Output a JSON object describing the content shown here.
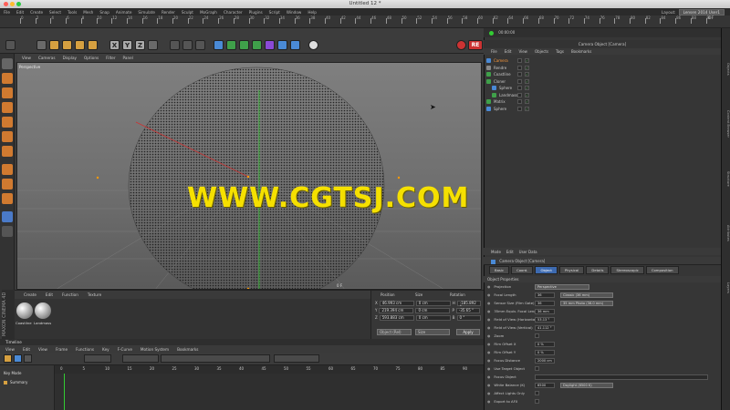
{
  "window": {
    "title": "Untitled 12 *"
  },
  "menubar": {
    "items": [
      "File",
      "Edit",
      "Create",
      "Select",
      "Tools",
      "Mesh",
      "Snap",
      "Animate",
      "Simulate",
      "Render",
      "Sculpt",
      "MoGraph",
      "Character",
      "Plugins",
      "Script",
      "Window",
      "Help"
    ],
    "layout_label": "Layout:",
    "layout_value": "Lensen 2014 User1"
  },
  "time_ruler": {
    "ticks": [
      "0",
      "2",
      "4",
      "6",
      "8",
      "10",
      "12",
      "14",
      "16",
      "18",
      "20",
      "22",
      "24",
      "26",
      "28",
      "30",
      "32",
      "34",
      "36",
      "38",
      "40",
      "42",
      "44",
      "46",
      "48",
      "50",
      "52",
      "54",
      "56",
      "58",
      "60",
      "62",
      "64",
      "66",
      "68",
      "70",
      "72",
      "74",
      "76",
      "78",
      "80",
      "82",
      "84",
      "86",
      "88",
      "90"
    ],
    "end_label": "0 F",
    "start_field": "0 F",
    "end_field": "90 F",
    "frame_field": "0 F"
  },
  "toolbar": {
    "axis_labels": [
      "X",
      "Y",
      "Z"
    ],
    "render_badge": "RE"
  },
  "viewport": {
    "menu": [
      "View",
      "Cameras",
      "Display",
      "Options",
      "Filter",
      "Panel"
    ],
    "label": "Perspective",
    "watermark": "WWW.CGTSJ.COM",
    "corner_label": "0 F"
  },
  "material_manager": {
    "menu": [
      "Create",
      "Edit",
      "Function",
      "Texture"
    ],
    "materials": [
      "Coastline",
      "Landmass"
    ],
    "vertical_label": "MAXON CINEMA 4D"
  },
  "coordinates": {
    "headers": [
      "Position",
      "Size",
      "Rotation"
    ],
    "rows": [
      {
        "axis": "X",
        "pos": "46.993 cm",
        "size": "0 cm",
        "rot": "H",
        "rot_val": "-185.892 °"
      },
      {
        "axis": "Y",
        "pos": "219.394 cm",
        "size": "0 cm",
        "rot": "P",
        "rot_val": "-35.65 °"
      },
      {
        "axis": "Z",
        "pos": "593.883 cm",
        "size": "0 cm",
        "rot": "B",
        "rot_val": "0 °"
      }
    ],
    "mode_select": "Object (Rel)",
    "size_select": "Size",
    "apply_label": "Apply"
  },
  "timeline": {
    "title": "Timeline",
    "menu": [
      "View",
      "Edit",
      "View",
      "Frame",
      "Functions",
      "Key",
      "F-Curve",
      "Motion System",
      "Bookmarks"
    ],
    "key_mode": "Key Mode",
    "summary": "Summary",
    "ruler": [
      "0",
      "5",
      "10",
      "15",
      "20",
      "25",
      "30",
      "35",
      "40",
      "45",
      "50",
      "55",
      "60",
      "65",
      "70",
      "75",
      "80",
      "85",
      "90"
    ]
  },
  "object_manager": {
    "time_display": "00:00:00",
    "title": "Camera Object [Camera]",
    "menu": [
      "File",
      "Edit",
      "View",
      "Objects",
      "Tags",
      "Bookmarks"
    ],
    "objects": [
      {
        "name": "Camera",
        "color": "#ff9a3a"
      },
      {
        "name": "Rendre",
        "color": "#cccccc"
      },
      {
        "name": "Coastline",
        "color": "#cccccc"
      },
      {
        "name": "Cloner",
        "color": "#cccccc"
      },
      {
        "name": "Sphere",
        "color": "#cccccc"
      },
      {
        "name": "Landmass",
        "color": "#cccccc"
      },
      {
        "name": "Matrix",
        "color": "#cccccc"
      },
      {
        "name": "Sphere",
        "color": "#cccccc"
      }
    ]
  },
  "attributes": {
    "menu": [
      "Mode",
      "Edit",
      "User Data"
    ],
    "title": "Camera Object [Camera]",
    "tabs": [
      "Basic",
      "Coord.",
      "Object",
      "Physical",
      "Details",
      "Stereoscopic",
      "Composition"
    ],
    "active_tab": "Object",
    "section": "Object Properties",
    "rows": [
      {
        "label": "Projection",
        "value": "Perspective",
        "kind": "drop"
      },
      {
        "label": "Focal Length",
        "value": "36",
        "extra": "Classic (36 mm)"
      },
      {
        "label": "Sensor Size (Film Gate)",
        "value": "36",
        "extra": "35 mm Photo (36.0 mm)"
      },
      {
        "label": "35mm Equiv. Focal Length:",
        "value": "36 mm"
      },
      {
        "label": "Field of View (Horizontal)",
        "value": "53.13 °"
      },
      {
        "label": "Field of View (Vertical)",
        "value": "41.112 °"
      },
      {
        "label": "Zoom",
        "value": ""
      },
      {
        "label": "Film Offset X",
        "value": "0 %"
      },
      {
        "label": "Film Offset Y",
        "value": "0 %"
      },
      {
        "label": "Focus Distance",
        "value": "2000 cm"
      },
      {
        "label": "Use Target Object",
        "value": ""
      },
      {
        "label": "Focus Object",
        "value": ""
      },
      {
        "label": "White Balance (K)",
        "value": "6500",
        "extra": "Daylight (6500 K)"
      },
      {
        "label": "Affect Lights Only",
        "value": ""
      },
      {
        "label": "Export to AFX",
        "value": ""
      }
    ]
  },
  "side_tabs": [
    "Objects",
    "Content Browser",
    "Structure",
    "Attributes",
    "Layers"
  ],
  "colors": {
    "accent_tab": "#3d6ab0",
    "watermark": "#f5e000",
    "camera_label": "#ff9a3a"
  }
}
